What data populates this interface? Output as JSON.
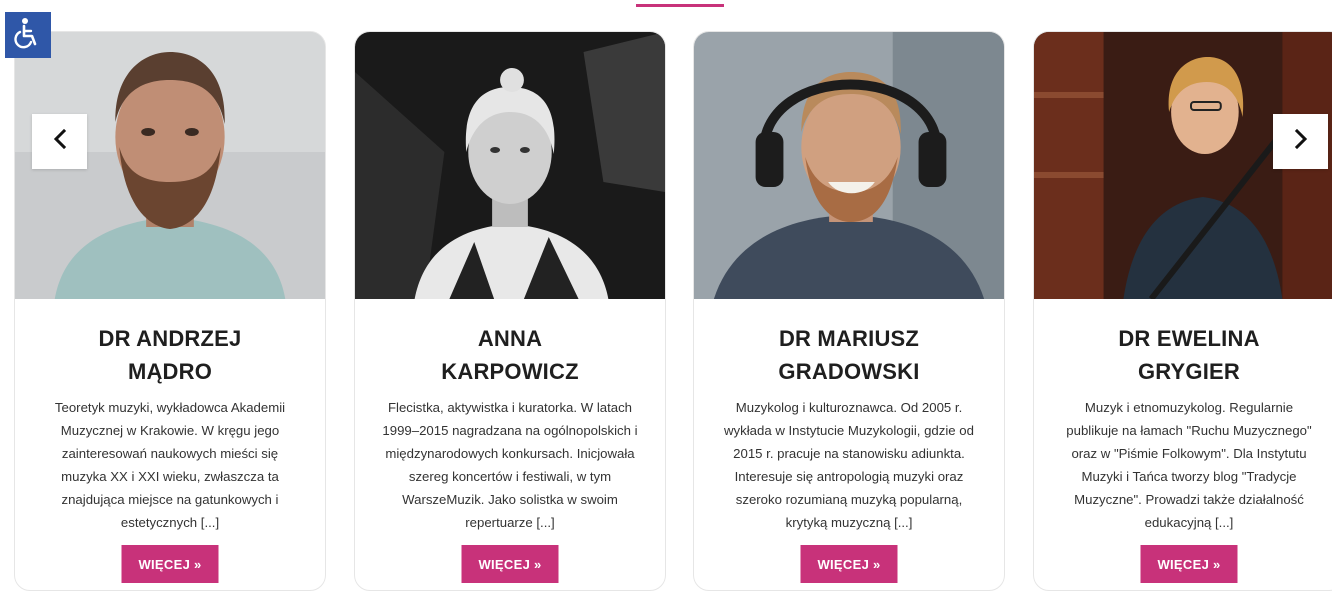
{
  "accessibility": {
    "icon": "wheelchair-icon",
    "color": "#2f57a8"
  },
  "accent_color": "#c8327a",
  "carousel": {
    "prev_icon": "chevron-left-icon",
    "next_icon": "chevron-right-icon"
  },
  "cards": [
    {
      "name_line1": "DR ANDRZEJ",
      "name_line2": "MĄDRO",
      "desc": [
        "Teoretyk muzyki, wykładowca Akademii",
        "Muzycznej w Krakowie. W kręgu jego",
        "zainteresowań naukowych mieści się",
        "muzyka XX i XXI wieku, zwłaszcza ta",
        "znajdująca miejsce na gatunkowych i",
        "estetycznych [...]"
      ],
      "button": "WIĘCEJ »"
    },
    {
      "name_line1": "ANNA",
      "name_line2": "KARPOWICZ",
      "desc": [
        "Flecistka, aktywistka i kuratorka. W latach",
        "1999–2015 nagradzana na ogólnopolskich i",
        "międzynarodowych konkursach. Inicjowała",
        "szereg koncertów i festiwali, w tym",
        "WarszeMuzik. Jako solistka w swoim",
        "repertuarze [...]"
      ],
      "button": "WIĘCEJ »"
    },
    {
      "name_line1": "DR MARIUSZ",
      "name_line2": "GRADOWSKI",
      "desc": [
        "Muzykolog i kulturoznawca. Od 2005 r.",
        "wykłada w Instytucie Muzykologii, gdzie od",
        "2015 r. pracuje na stanowisku adiunkta.",
        "Interesuje się antropologią muzyki oraz",
        "szeroko rozumianą muzyką popularną,",
        "krytyką muzyczną [...]"
      ],
      "button": "WIĘCEJ »"
    },
    {
      "name_line1": "DR EWELINA",
      "name_line2": "GRYGIER",
      "desc": [
        "Muzyk i etnomuzykolog. Regularnie",
        "publikuje na łamach \"Ruchu Muzycznego\"",
        "oraz w \"Piśmie Folkowym\". Dla Instytutu",
        "Muzyki i Tańca tworzy blog \"Tradycje",
        "Muzyczne\". Prowadzi także działalność",
        "edukacyjną [...]"
      ],
      "button": "WIĘCEJ »"
    }
  ]
}
